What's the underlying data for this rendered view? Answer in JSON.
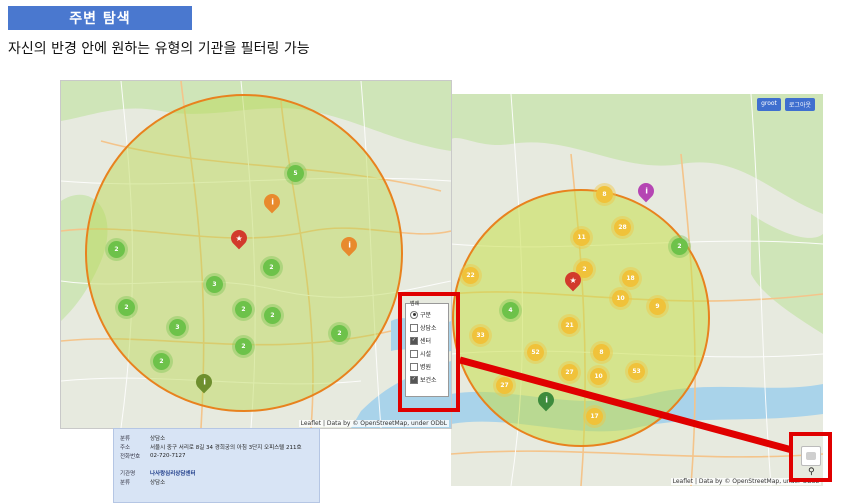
{
  "header": {
    "title": "주변 탐색",
    "subtitle": "자신의 반경 안에 원하는 유형의 기관을 필터링 가능"
  },
  "map_left": {
    "attribution": "Leaflet | Data by © OpenStreetMap, under ODbL",
    "clusters": [
      "5",
      "2",
      "2",
      "3",
      "2",
      "2",
      "3",
      "2",
      "2",
      "2",
      "2"
    ],
    "filter": {
      "header": "범례",
      "options": [
        {
          "label": "구분",
          "type": "radio",
          "checked": true
        },
        {
          "label": "상담소",
          "type": "checkbox",
          "checked": false
        },
        {
          "label": "센터",
          "type": "checkbox",
          "checked": true
        },
        {
          "label": "시설",
          "type": "checkbox",
          "checked": false
        },
        {
          "label": "병원",
          "type": "checkbox",
          "checked": false
        },
        {
          "label": "보건소",
          "type": "checkbox",
          "checked": true
        }
      ]
    }
  },
  "map_right": {
    "buttons": [
      "groot",
      "로그아웃"
    ],
    "attribution": "Leaflet | Data by © OpenStreetMap, under ODbL",
    "clusters": [
      "8",
      "11",
      "28",
      "2",
      "22",
      "2",
      "18",
      "10",
      "4",
      "21",
      "9",
      "33",
      "52",
      "8",
      "27",
      "27",
      "10",
      "53",
      "17"
    ]
  },
  "info_card": {
    "rows": [
      {
        "key": "분류",
        "value": "상담소"
      },
      {
        "key": "주소",
        "value": "서울시 중구 서리로 8길 34 경희궁의 아침 3단지 오피스텔 211호"
      },
      {
        "key": "전화번호",
        "value": "02-720-7127"
      },
      {
        "key": "기관명",
        "value": "나사랑심리상담센터"
      },
      {
        "key": "분류",
        "value": "상담소"
      }
    ]
  },
  "colors": {
    "title_bar": "#4a78cf",
    "highlight": "#e00000",
    "radius_circle": "#e8821e",
    "cluster_green": "#6dc24a",
    "cluster_yellow": "#f0c23a"
  }
}
